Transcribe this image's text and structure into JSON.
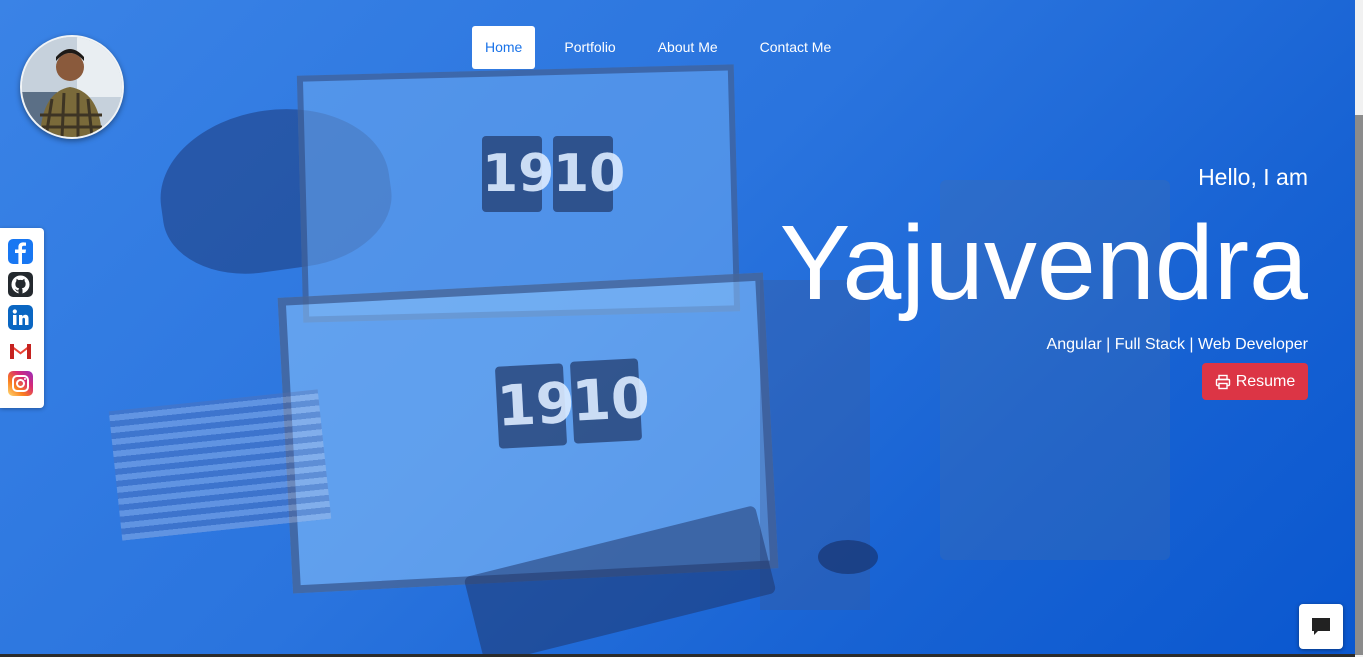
{
  "nav": {
    "items": [
      {
        "label": "Home",
        "active": true
      },
      {
        "label": "Portfolio",
        "active": false
      },
      {
        "label": "About Me",
        "active": false
      },
      {
        "label": "Contact Me",
        "active": false
      }
    ]
  },
  "background_clock": [
    "19",
    "10"
  ],
  "social": [
    {
      "icon": "facebook-icon",
      "color": "#1877f2"
    },
    {
      "icon": "github-icon",
      "color": "#24292e"
    },
    {
      "icon": "linkedin-icon",
      "color": "#0a66c2"
    },
    {
      "icon": "gmail-icon",
      "color": "#ea4335"
    },
    {
      "icon": "instagram-icon",
      "color": "#e1306c"
    }
  ],
  "hero": {
    "greeting": "Hello, I am",
    "name": "Yajuvendra",
    "tagline": "Angular | Full Stack | Web Developer",
    "resume_label": "Resume",
    "resume_icon": "printer-icon",
    "resume_color": "#dc3545"
  },
  "chat": {
    "icon": "chat-icon"
  },
  "colors": {
    "primary": "#1a73e8",
    "accent": "#dc3545"
  }
}
